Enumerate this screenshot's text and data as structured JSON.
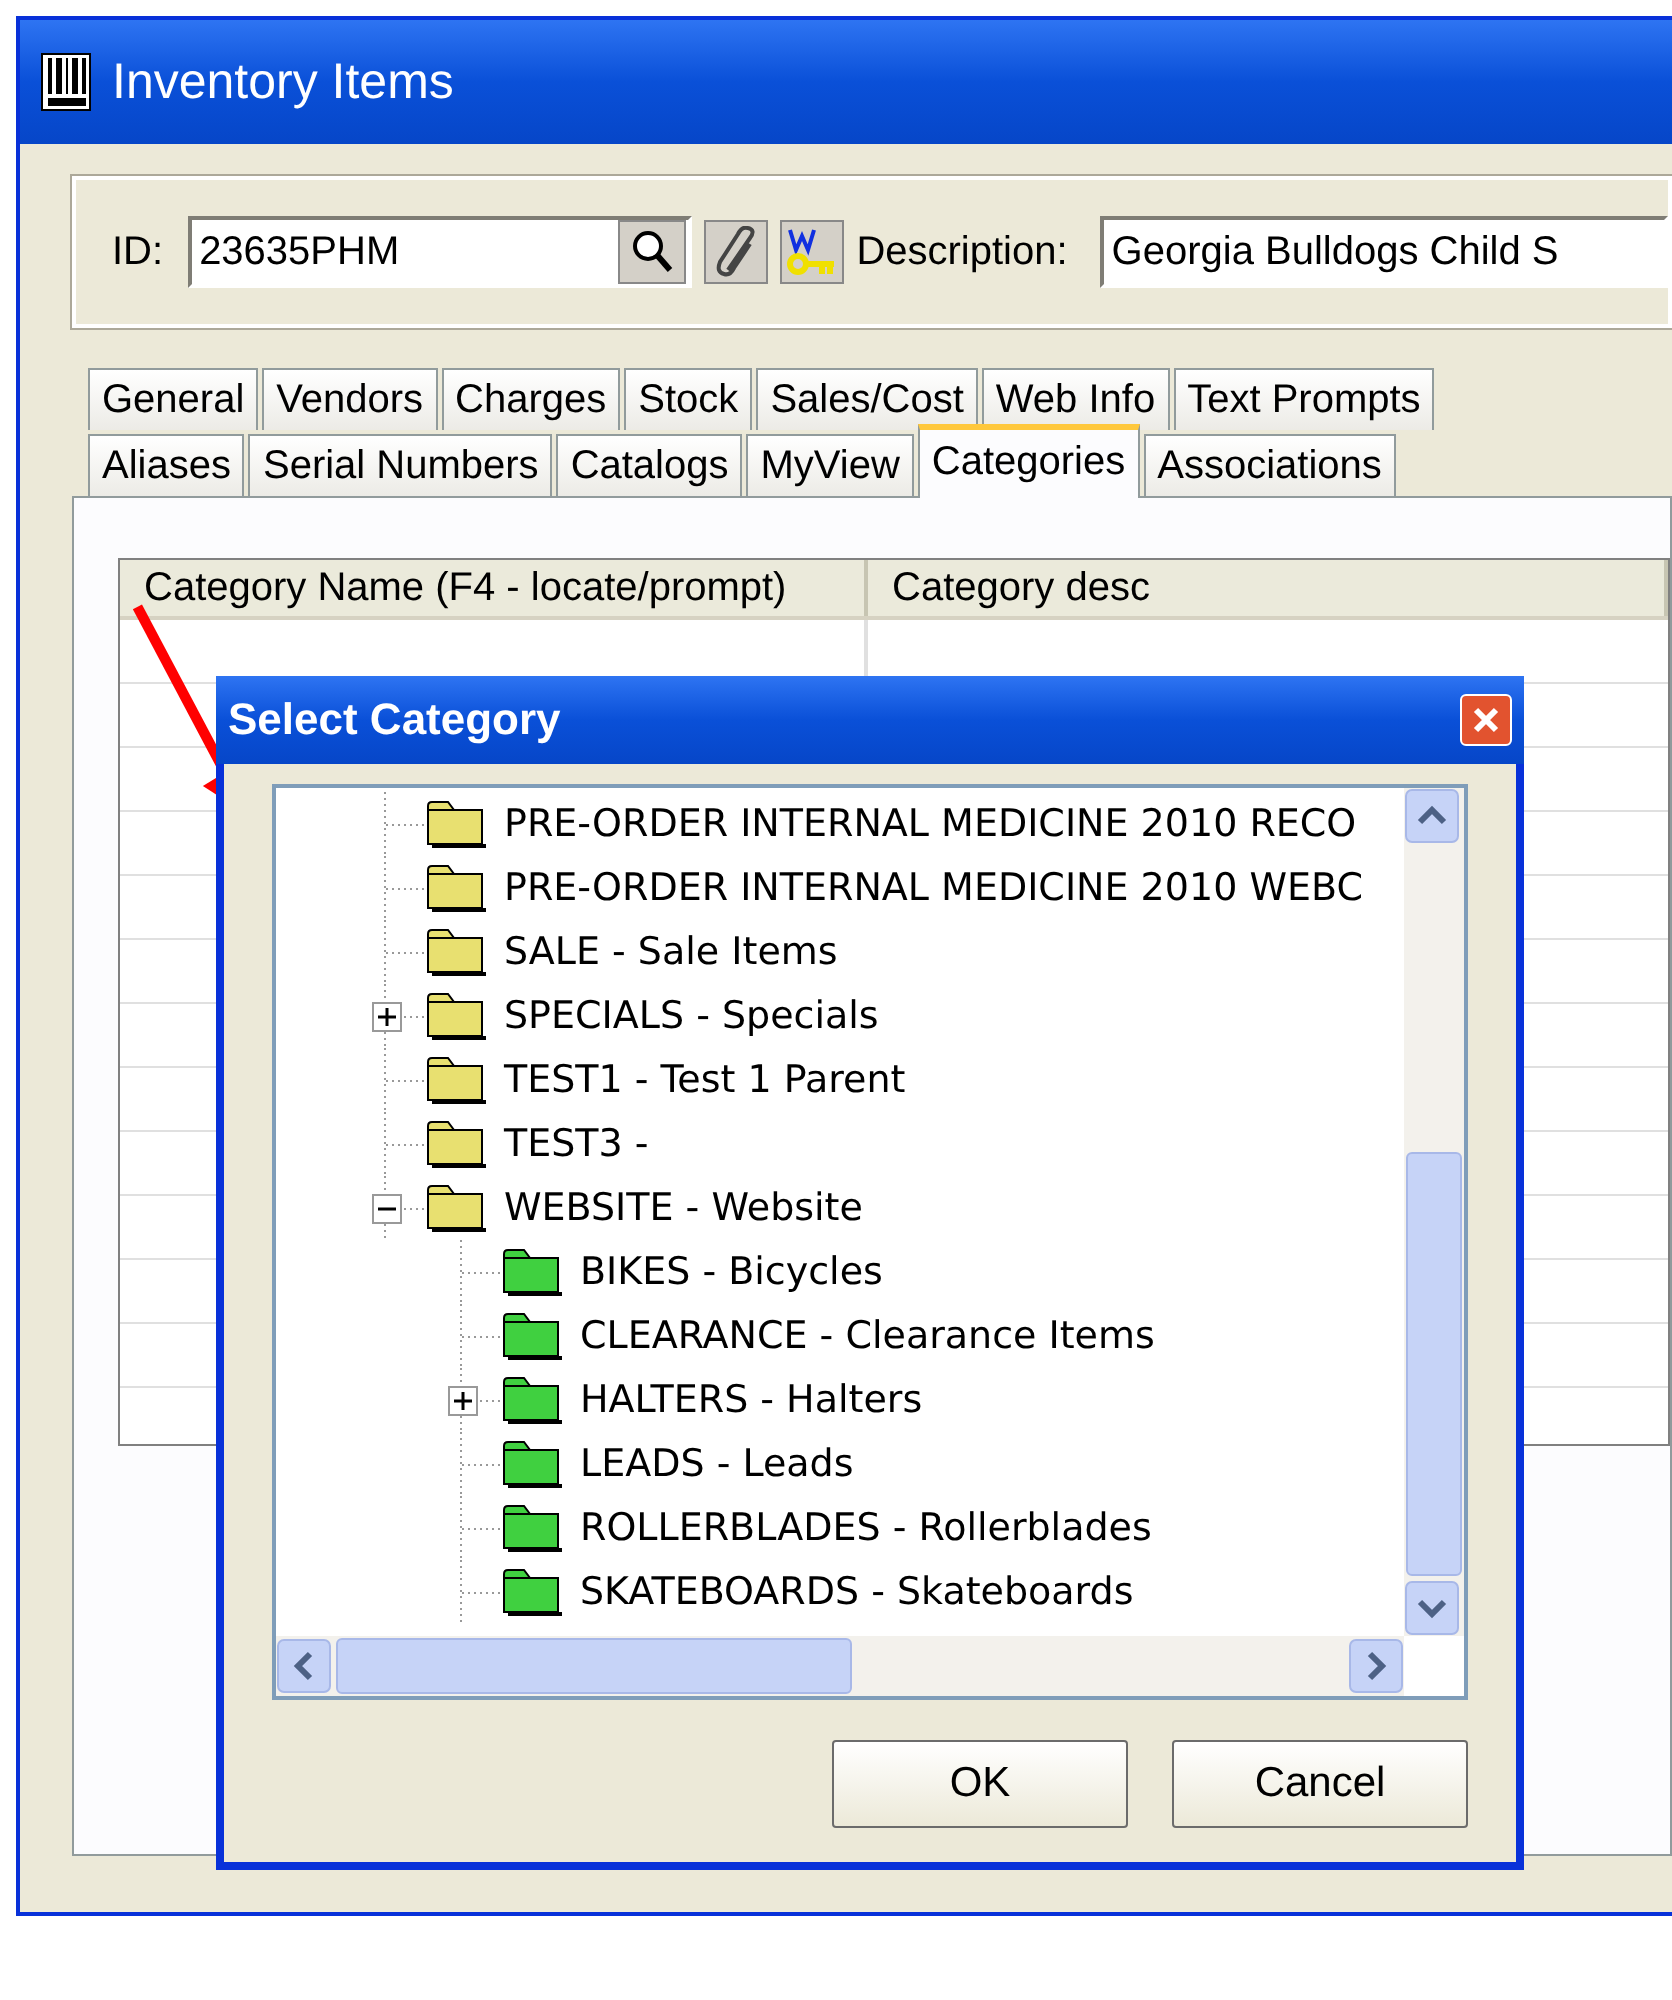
{
  "window": {
    "title": "Inventory Items"
  },
  "header": {
    "id_label": "ID:",
    "id_value": "23635PHM",
    "description_label": "Description:",
    "description_value": "Georgia Bulldogs Child S"
  },
  "tab_rows": [
    {
      "tabs": [
        {
          "label": "General",
          "selected": false
        },
        {
          "label": "Vendors",
          "selected": false
        },
        {
          "label": "Charges",
          "selected": false
        },
        {
          "label": "Stock",
          "selected": false
        },
        {
          "label": "Sales/Cost",
          "selected": false
        },
        {
          "label": "Web Info",
          "selected": false
        },
        {
          "label": "Text Prompts",
          "selected": false
        }
      ]
    },
    {
      "tabs": [
        {
          "label": "Aliases",
          "selected": false
        },
        {
          "label": "Serial Numbers",
          "selected": false
        },
        {
          "label": "Catalogs",
          "selected": false
        },
        {
          "label": "MyView",
          "selected": false
        },
        {
          "label": "Categories",
          "selected": true
        },
        {
          "label": "Associations",
          "selected": false
        }
      ]
    }
  ],
  "grid": {
    "columns": [
      "Category Name (F4 - locate/prompt)",
      "Category desc"
    ]
  },
  "dialog": {
    "title": "Select Category",
    "tree": [
      {
        "label": "PRE-ORDER INTERNAL MEDICINE 2010 RECO",
        "color": "#e8e070"
      },
      {
        "label": "PRE-ORDER INTERNAL MEDICINE 2010 WEBC",
        "color": "#e8e070"
      },
      {
        "label": "SALE - Sale Items",
        "color": "#e8e070"
      },
      {
        "label": "SPECIALS - Specials",
        "color": "#e8e070",
        "expanded": false
      },
      {
        "label": "TEST1 - Test 1 Parent",
        "color": "#e8e070"
      },
      {
        "label": "TEST3 -",
        "color": "#e8e070"
      },
      {
        "label": "WEBSITE - Website",
        "color": "#e8e070",
        "expanded": true,
        "children": [
          {
            "label": "BIKES - Bicycles",
            "color": "#40d040"
          },
          {
            "label": "CLEARANCE - Clearance Items",
            "color": "#40d040"
          },
          {
            "label": "HALTERS - Halters",
            "color": "#40d040",
            "expanded": false
          },
          {
            "label": "LEADS - Leads",
            "color": "#40d040"
          },
          {
            "label": "ROLLERBLADES - Rollerblades",
            "color": "#40d040"
          },
          {
            "label": "SKATEBOARDS - Skateboards",
            "color": "#40d040"
          }
        ]
      }
    ],
    "buttons": [
      "OK",
      "Cancel"
    ]
  }
}
